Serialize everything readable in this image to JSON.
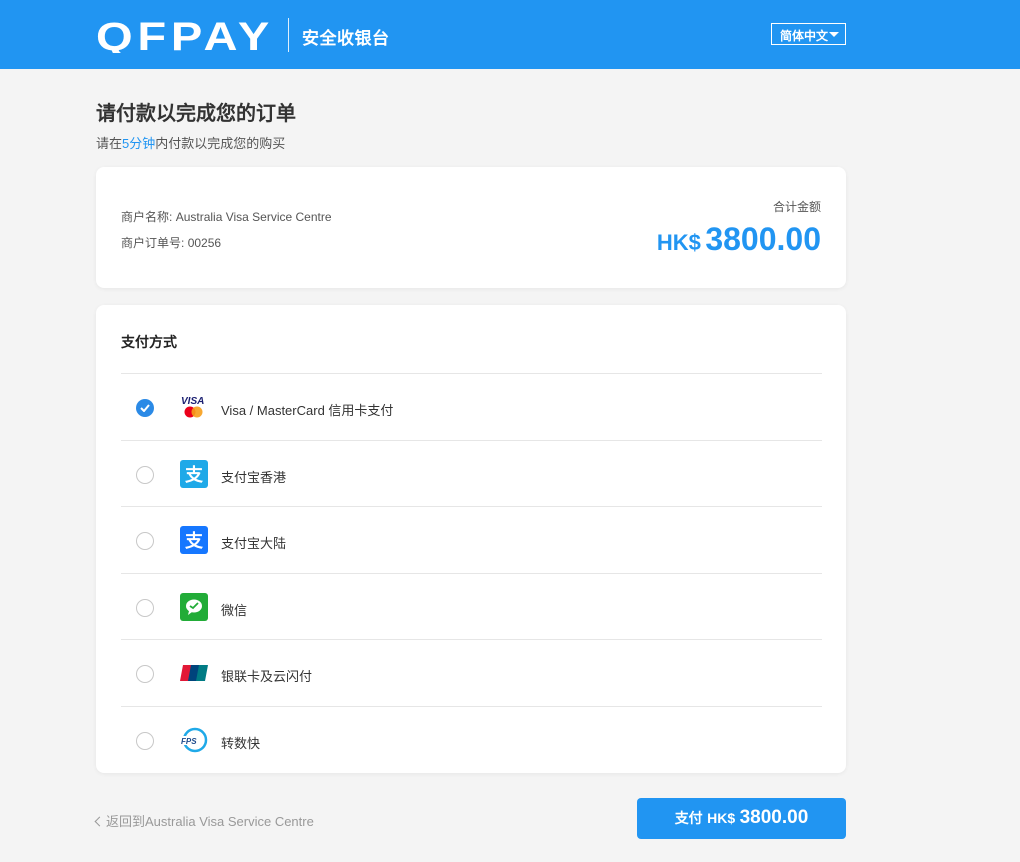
{
  "header": {
    "logo_text": "QFPay",
    "subtitle": "安全收银台",
    "language": "简体中文",
    "brand_color": "#2195f2"
  },
  "page": {
    "title": "请付款以完成您的订单",
    "subtitle_prefix": "请在",
    "subtitle_highlight": "5分钟",
    "subtitle_suffix": "内付款以完成您的购买"
  },
  "order": {
    "merchant_label": "商户名称:",
    "merchant_name": "Australia Visa Service Centre",
    "order_no_label": "商户订单号:",
    "order_no": "00256",
    "total_label": "合计金额",
    "currency": "HK$",
    "amount": "3800.00"
  },
  "payment": {
    "title": "支付方式",
    "methods": [
      {
        "label": "Visa / MasterCard 信用卡支付",
        "icon": "visa-mastercard-icon",
        "selected": true
      },
      {
        "label": "支付宝香港",
        "icon": "alipay-hk-icon",
        "selected": false
      },
      {
        "label": "支付宝大陆",
        "icon": "alipay-icon",
        "selected": false
      },
      {
        "label": "微信",
        "icon": "wechat-icon",
        "selected": false
      },
      {
        "label": "银联卡及云闪付",
        "icon": "unionpay-icon",
        "selected": false
      },
      {
        "label": "转数快",
        "icon": "fps-icon",
        "selected": false
      }
    ]
  },
  "footer": {
    "back_text": "返回到Australia Visa Service Centre",
    "pay_prefix": "支付",
    "pay_currency": "HK$",
    "pay_amount": "3800.00"
  }
}
